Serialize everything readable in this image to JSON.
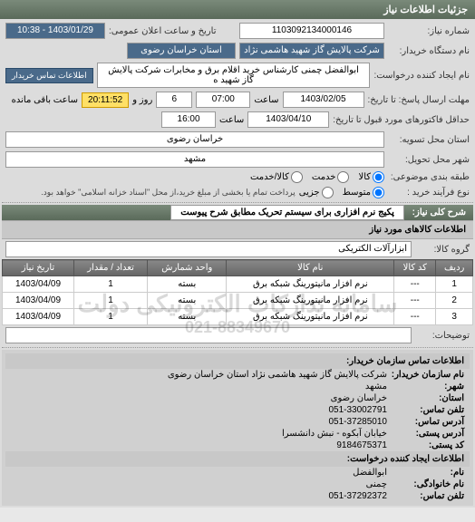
{
  "tab": {
    "title": "جزئیات اطلاعات نیاز"
  },
  "header": {
    "need_no_label": "شماره نیاز:",
    "need_no": "1103092134000146",
    "announce_label": "تاریخ و ساعت اعلان عمومی:",
    "announce_value": "1403/01/29 - 10:38",
    "buyer_label": "نام دستگاه خریدار:",
    "buyer_value_1": "شرکت پالایش گاز شهید هاشمی نژاد",
    "buyer_value_2": "استان خراسان رضوی",
    "requester_label": "نام ایجاد کننده درخواست:",
    "requester_value": "ابوالفضل چمنی کارشناس خرید اقلام برق و مخابرات شرکت پالایش گاز شهید ه",
    "contact_btn": "اطلاعات تماس خریدار",
    "deadline_resp_label": "مهلت ارسال پاسخ: تا تاریخ:",
    "deadline_resp_date": "1403/02/05",
    "deadline_time_label": "ساعت",
    "deadline_resp_time": "07:00",
    "remain_days": "6",
    "remain_days_label": "روز و",
    "remain_time": "20:11:52",
    "remain_label": "ساعت باقی مانده",
    "factor_label": "حداقل فاکتورهای مورد قبول تا تاریخ:",
    "factor_date": "1403/04/10",
    "factor_time": "16:00",
    "province_label": "استان محل تسویه:",
    "province_value": "خراسان رضوی",
    "city_label": "شهر محل تحویل:",
    "city_value": "مشهد",
    "class_label": "طبقه بندی موضوعی:",
    "class_opts": [
      "کالا",
      "خدمت",
      "کالا/خدمت"
    ],
    "process_label": "نوع فرآیند خرید :",
    "process_opts": [
      "متوسط",
      "جزیی"
    ],
    "process_note": "پرداخت تمام یا بخشی از مبلغ خرید،از محل \"اسناد خزانه اسلامی\" خواهد بود.",
    "desc_label": "شرح کلی نیاز:",
    "desc_value": "پکیج نرم افزاری برای سیستم تحریک مطابق شرح پیوست"
  },
  "items_section": {
    "title": "اطلاعات کالاهای مورد نیاز",
    "group_label": "گروه کالا:",
    "group_value": "ابزارآلات الکتریکی",
    "cols": [
      "ردیف",
      "کد کالا",
      "نام کالا",
      "واحد شمارش",
      "تعداد / مقدار",
      "تاریخ نیاز"
    ],
    "rows": [
      {
        "idx": "1",
        "code": "---",
        "name": "نرم افزار مانیتورینگ شبکه برق",
        "unit": "بسته",
        "qty": "1",
        "date": "1403/04/09"
      },
      {
        "idx": "2",
        "code": "---",
        "name": "نرم افزار مانیتورینگ شبکه برق",
        "unit": "بسته",
        "qty": "1",
        "date": "1403/04/09"
      },
      {
        "idx": "3",
        "code": "---",
        "name": "نرم افزار مانیتورینگ شبکه برق",
        "unit": "بسته",
        "qty": "1",
        "date": "1403/04/09"
      }
    ],
    "desc_label": "توضیحات:"
  },
  "watermark": {
    "line1": "سامانه تدارکات الکترونیکی دولت",
    "line2": "021-88349670"
  },
  "footer": {
    "org_title": "اطلاعات تماس سازمان خریدار:",
    "org_name_label": "نام سازمان خریدار:",
    "org_name": "شرکت پالایش گاز شهید هاشمی نژاد استان خراسان رضوی",
    "city_label": "شهر:",
    "city": "مشهد",
    "province_label": "استان:",
    "province": "خراسان رضوی",
    "phone_label": "تلفن تماس:",
    "phone": "051-33002791",
    "addr_label": "آدرس تماس:",
    "addr": "051-37285010",
    "post_addr_label": "آدرس پستی:",
    "post_addr": "خیابان آبکوه - نبش دانشسرا",
    "post_code_label": "کد پستی:",
    "post_code": "9184675371",
    "creator_title": "اطلاعات ایجاد کننده درخواست:",
    "fname_label": "نام:",
    "fname": "ابوالفضل",
    "lname_label": "نام خانوادگی:",
    "lname": "چمنی",
    "creator_phone_label": "تلفن تماس:",
    "creator_phone": "051-37292372"
  }
}
